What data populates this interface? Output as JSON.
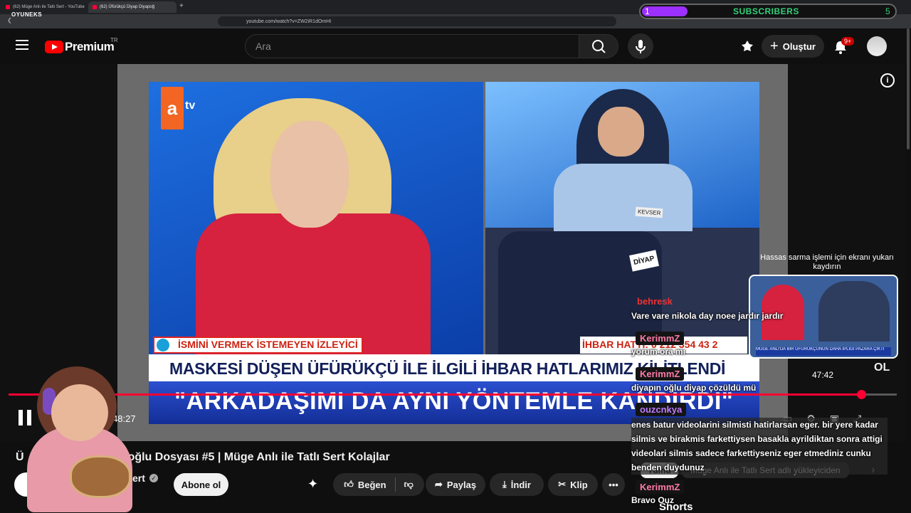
{
  "browser": {
    "tabs": [
      {
        "label": "(62) Müge Anlı ile Tatlı Sert - YouTube"
      },
      {
        "label": "(62) Üfürükçü Diyap Diyapoğ"
      }
    ],
    "new_tab_glyph": "+",
    "url": "youtube.com/watch?v=ZW2iR1dOmHI",
    "extension_logo": "OYUNEKS"
  },
  "overlay": {
    "subs_label": "SUBSCRIBERS",
    "subs_start": "1",
    "subs_goal": "5",
    "sensitive_hint": "Hassas sarma işlemi için ekranı yukarı kaydırın",
    "preview_time": "47:42",
    "preview_caption": "MÜGE ANLI'DA BİR ÜFÜRÜKÇÜNÜN DAHA İPLİĞİ PAZARA ÇIKTI",
    "abone_logo": "OL"
  },
  "youtube": {
    "brand": "Premium",
    "country": "TR",
    "search_placeholder": "Ara",
    "create_label": "Oluştur",
    "notif_badge": "9+",
    "icons": [
      "menu-icon",
      "search-icon",
      "mic-icon",
      "upload-icon",
      "plus-icon",
      "bell-icon"
    ]
  },
  "video": {
    "channel_logo": "a",
    "channel_logo_suffix": "tv",
    "lower_third": "İSMİNİ VERMEK İSTEMEYEN İZLEYİCİ",
    "ihbar": "İHBAR HATTI: 0 212 354 43 2",
    "headline": "MASKESİ DÜŞEN ÜFÜRÜKÇÜ İLE İLGİLİ İHBAR HATLARIMIZ KİLİTLENDİ",
    "quote": "\"ARKADAŞIMI DA AYNI YÖNTEMLE KANDIRDI\"",
    "name_tag_1": "KEVSER",
    "name_tag_2": "DİYAP",
    "timecode": "6 / 48:27",
    "progress": 0.96
  },
  "chat": [
    {
      "user": "behresk",
      "message": "Vare vare nikola day noee jardır jardır"
    },
    {
      "user": "KerimmZ",
      "message": "yorum ora mı"
    },
    {
      "user": "KerimmZ",
      "message": "diyapın oğlu diyap çözüldü mü"
    },
    {
      "user": "ouzcnkya",
      "message": "enes batur videolarini silmisti hatirlarsan eger. bir yere kadar silmis ve birakmis farkettiysen basakla ayrildiktan sonra attigi videolari silmis sadece farkettiyseniz eger etmediniz cunku benden duydunuz"
    },
    {
      "user": "KerimmZ",
      "message": "Bravo Ouz"
    }
  ],
  "below": {
    "title_start": "Ü",
    "title": "oğlu Dosyası #5 | Müge Anlı ile Tatlı Sert Kolajlar",
    "channel_suffix": "ert",
    "subscribe_label": "Abone ol",
    "like_label": "Beğen",
    "share_label": "Paylaş",
    "download_label": "İndir",
    "clip_label": "Klip",
    "more_label": "•••",
    "chip_all": "Tümü",
    "chip_uploader": "Müge Anlı ile Tatlı Sert adlı yükleyiciden",
    "shorts_label": "Shorts"
  },
  "colors": {
    "accent": "#ff0033",
    "subs_text": "#33d17a",
    "subs_fill": "#9b30ff",
    "chat_user": "#ff7aa8"
  }
}
